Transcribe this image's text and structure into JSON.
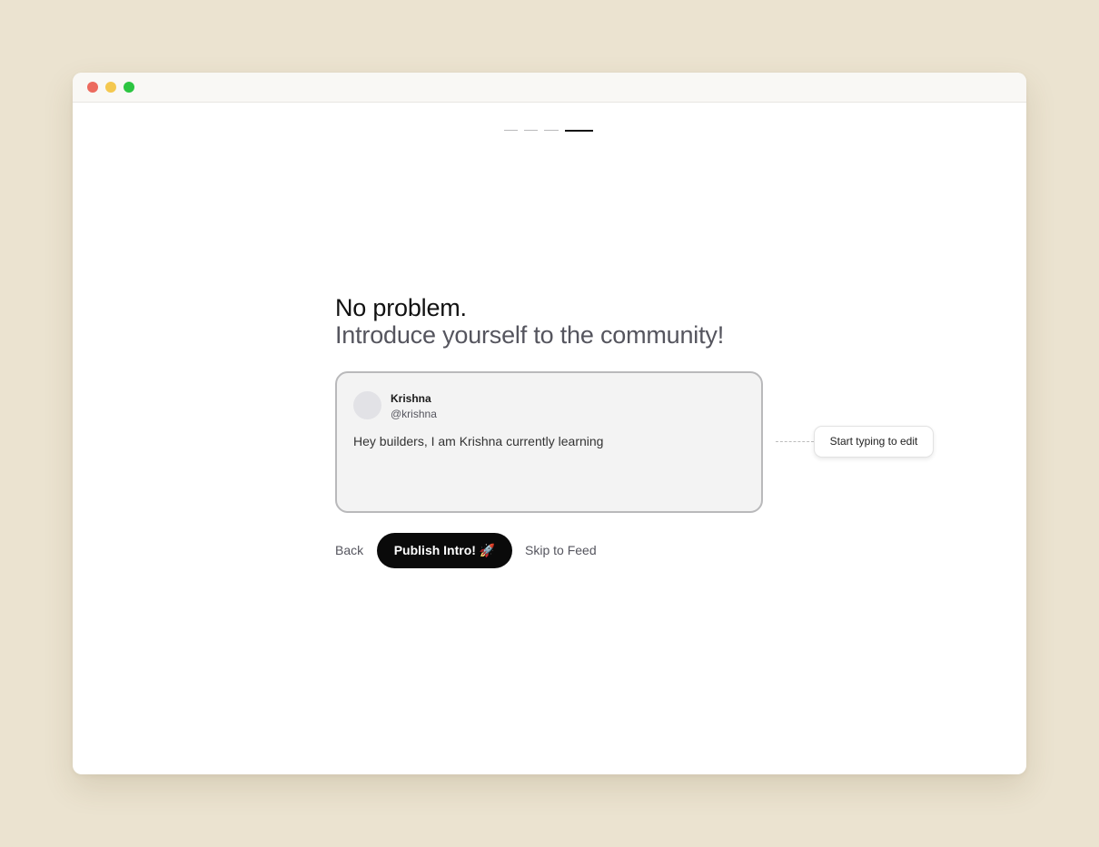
{
  "progress": {
    "total_steps": 4,
    "current_step": 4
  },
  "heading": {
    "line1": "No problem.",
    "line2": "Introduce yourself to the community!"
  },
  "post_card": {
    "user_name": "Krishna",
    "user_handle": "@krishna",
    "text": "Hey builders, I am Krishna currently learning"
  },
  "hint": {
    "label": "Start typing to edit"
  },
  "actions": {
    "back_label": "Back",
    "publish_label": "Publish Intro! 🚀",
    "skip_label": "Skip to Feed"
  },
  "colors": {
    "page_background": "#ebe3d0",
    "primary_button": "#0a0a0a",
    "card_background": "#f3f3f3",
    "window_close": "#ec6a5e",
    "window_minimize": "#f4c84f",
    "window_maximize": "#2cc541"
  }
}
